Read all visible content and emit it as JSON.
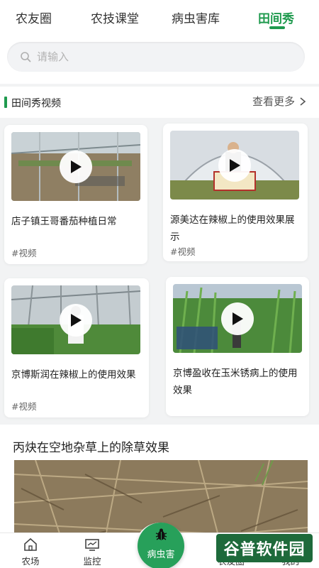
{
  "top_tabs": [
    {
      "label": "农友圈",
      "active": false
    },
    {
      "label": "农技课堂",
      "active": false
    },
    {
      "label": "病虫害库",
      "active": false
    },
    {
      "label": "田间秀",
      "active": true
    }
  ],
  "search": {
    "placeholder": "请输入",
    "value": ""
  },
  "section": {
    "title": "田间秀视频",
    "more_label": "查看更多"
  },
  "videos": [
    {
      "title": "店子镇王哥番茄种植日常",
      "tag": "#视频"
    },
    {
      "title": "源美达在辣椒上的使用效果展示",
      "tag": "#视频"
    },
    {
      "title": "京博斯润在辣椒上的使用效果",
      "tag": "#视频"
    },
    {
      "title": "京博盈收在玉米锈病上的使用效果",
      "tag": ""
    }
  ],
  "article": {
    "title": "丙炔在空地杂草上的除草效果"
  },
  "bottom_nav": [
    {
      "label": "农场",
      "icon": "home-icon"
    },
    {
      "label": "监控",
      "icon": "monitor-icon"
    },
    {
      "label": "病虫害",
      "icon": "bug-icon"
    },
    {
      "label": "农友圈",
      "icon": "community-icon"
    },
    {
      "label": "我的",
      "icon": "user-icon"
    }
  ],
  "watermark": {
    "text": "谷普软件园"
  },
  "colors": {
    "accent": "#1f9a4e",
    "center_button": "#27a05a"
  }
}
